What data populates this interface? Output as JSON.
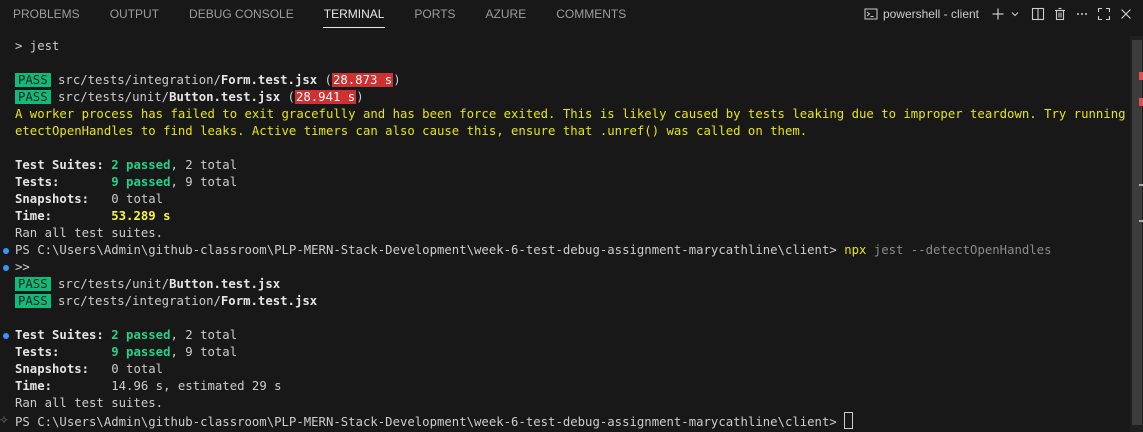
{
  "tabs": [
    "PROBLEMS",
    "OUTPUT",
    "DEBUG CONSOLE",
    "TERMINAL",
    "PORTS",
    "AZURE",
    "COMMENTS"
  ],
  "active_tab": "TERMINAL",
  "terminal_name": "powershell - client",
  "icons": [
    "terminal-icon",
    "plus-icon",
    "chevron-down-icon",
    "split-icon",
    "trash-icon",
    "more-icon",
    "maximize-icon",
    "close-icon"
  ],
  "colors": {
    "pass_bg": "#0dbc79",
    "fail_bg": "#cd3131",
    "warning": "#e5e510",
    "passed": "#23d18b",
    "accent_dot": "#3794ff"
  },
  "out": {
    "cmd1": "> jest",
    "pass_label": "PASS",
    "r1_prefix": "src/tests/integration/",
    "r1_file": "Form.test.jsx",
    "r1_open": " (",
    "r1_time": "28.873 s",
    "r1_close": ")",
    "r2_prefix": "src/tests/unit/",
    "r2_file": "Button.test.jsx",
    "r2_open": " (",
    "r2_time": "28.941 s",
    "r2_close": ")",
    "warn1": "A worker process has failed to exit gracefully and has been force exited. This is likely caused by tests leaking due to improper teardown. Try running with --d",
    "warn2": "etectOpenHandles to find leaks. Active timers can also cause this, ensure that .unref() was called on them.",
    "suites_label": "Test Suites: ",
    "suites_passed": "2 passed",
    "suites_total": ", 2 total",
    "tests_label": "Tests:       ",
    "tests_passed": "9 passed",
    "tests_total": ", 9 total",
    "snap_label": "Snapshots:   ",
    "snap_val": "0 total",
    "time_label": "Time:        ",
    "time1": "53.289 s",
    "ran": "Ran all test suites.",
    "prompt": "PS C:\\Users\\Admin\\github-classroom\\PLP-MERN-Stack-Development\\week-6-test-debug-assignment-marycathline\\client> ",
    "cmd2": "npx",
    "cmd2_args": " jest --detectOpenHandles",
    "cont": ">>",
    "r3_prefix": "src/tests/unit/",
    "r3_file": "Button.test.jsx",
    "r4_prefix": "src/tests/integration/",
    "r4_file": "Form.test.jsx",
    "suites2_passed": "2 passed",
    "suites2_total": ", 2 total",
    "tests2_passed": "9 passed",
    "tests2_total": ", 9 total",
    "snap2_val": "0 total",
    "time2": "14.96 s, estimated 29 s",
    "ran2": "Ran all test suites."
  }
}
